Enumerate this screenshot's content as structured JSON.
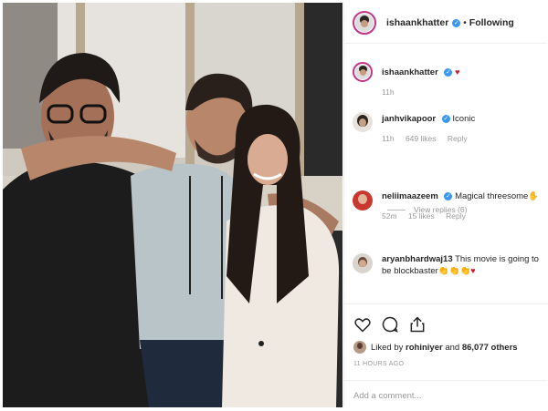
{
  "header": {
    "username": "ishaankhatter",
    "verified_mark": "✓",
    "separator": "•",
    "follow_state": "Following"
  },
  "comments": [
    {
      "user": "ishaankhatter",
      "text": "",
      "heart": "♥",
      "time": "11h",
      "likes": "",
      "reply": ""
    },
    {
      "user": "janhvikapoor",
      "text": "Iconic",
      "time": "11h",
      "likes": "649 likes",
      "reply": "Reply"
    },
    {
      "user": "neliimaazeem",
      "text": "Magical threesome",
      "emoji": "✋",
      "time": "52m",
      "likes": "15 likes",
      "reply": "Reply"
    },
    {
      "user": "aryanbhardwaj13",
      "text": "This movie is going to be blockbaster",
      "emoji": "👏👏👏",
      "heart": "♥"
    }
  ],
  "view_replies": "View replies (6)",
  "post": {
    "liked_by_prefix": "Liked by",
    "liked_by_user": "rohiniyer",
    "liked_and": "and",
    "likes_count": "86,077 others",
    "timestamp": "11 HOURS AGO",
    "add_comment_placeholder": "Add a comment..."
  },
  "icons": [
    "heart-outline-icon",
    "comment-icon",
    "share-icon"
  ],
  "colors": {
    "verified": "#3897f0",
    "heart": "#d0152f",
    "muted": "#999999",
    "story_ring": "#c13584"
  }
}
